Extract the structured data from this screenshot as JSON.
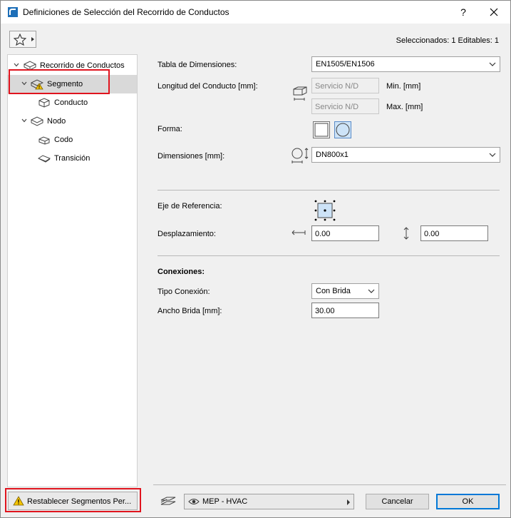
{
  "window": {
    "title": "Definiciones de Selección del Recorrido de Conductos",
    "help": "?",
    "close": "✕"
  },
  "header": {
    "status": "Seleccionados: 1 Editables: 1"
  },
  "tree": {
    "items": [
      {
        "label": "Recorrido de Conductos"
      },
      {
        "label": "Segmento"
      },
      {
        "label": "Conducto"
      },
      {
        "label": "Nodo"
      },
      {
        "label": "Codo"
      },
      {
        "label": "Transición"
      }
    ]
  },
  "reset_button": {
    "label": "Restablecer Segmentos Per..."
  },
  "form": {
    "dimension_table": {
      "label": "Tabla de Dimensiones:",
      "value": "EN1505/EN1506"
    },
    "duct_length": {
      "label": "Longitud del Conducto [mm]:",
      "min_value": "Servicio N/D",
      "min_label": "Min. [mm]",
      "max_value": "Servicio N/D",
      "max_label": "Max. [mm]"
    },
    "shape": {
      "label": "Forma:"
    },
    "dimensions": {
      "label": "Dimensiones [mm]:",
      "value": "DN800x1"
    },
    "reference_axis": {
      "label": "Eje de Referencia:"
    },
    "offset": {
      "label": "Desplazamiento:",
      "h_value": "0.00",
      "v_value": "0.00"
    },
    "connections": {
      "heading": "Conexiones:",
      "type_label": "Tipo Conexión:",
      "type_value": "Con Brida",
      "width_label": "Ancho Brida [mm]:",
      "width_value": "30.00"
    }
  },
  "footer": {
    "layer": "MEP - HVAC",
    "cancel": "Cancelar",
    "ok": "OK"
  },
  "colors": {
    "highlight": "#e0141e",
    "accent": "#0078d7"
  }
}
